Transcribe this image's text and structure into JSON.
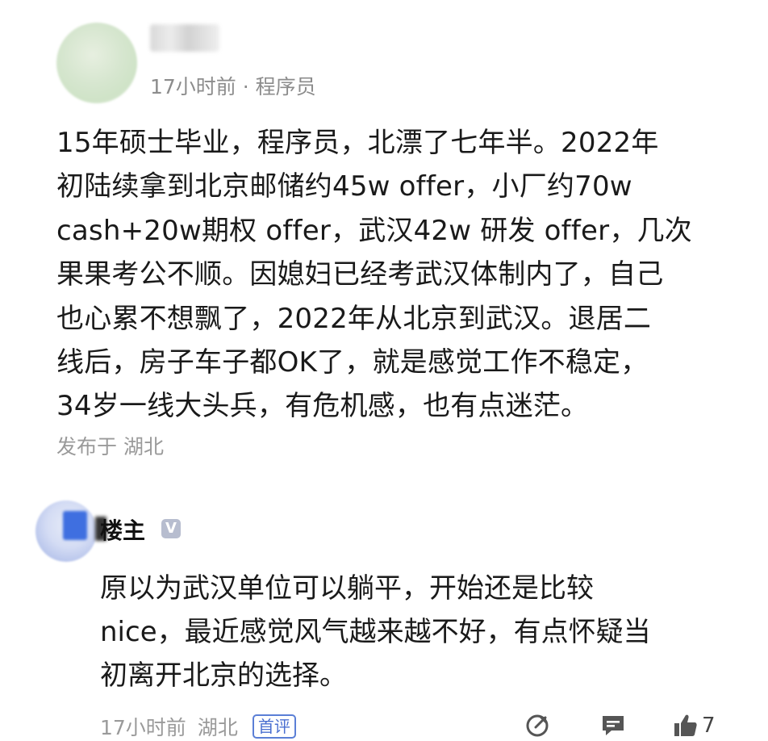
{
  "post": {
    "meta": "17小时前 · 程序员",
    "body_lines": [
      "15年硕士毕业，程序员，北漂了七年半。2022年",
      "初陆续拿到北京邮储约45w offer，小厂约70w",
      "cash+20w期权 offer，武汉42w 研发 offer，几次",
      "果果考公不顺。因媳妇已经考武汉体制内了，自己",
      "也心累不想飘了，2022年从北京到武汉。退居二",
      "线后，房子车子都OK了，就是感觉工作不稳定，",
      "34岁一线大头兵，有危机感，也有点迷茫。"
    ],
    "location": "发布于 湖北"
  },
  "reply": {
    "author": "楼主",
    "verified_mark": "V",
    "body_lines": [
      "原以为武汉单位可以躺平，开始还是比较",
      "nice，最近感觉风气越来越不好，有点怀疑当",
      "初离开北京的选择。"
    ],
    "time": "17小时前",
    "location": "湖北",
    "badge": "首评",
    "like_count": "7",
    "icons": [
      "share-icon",
      "comment-icon",
      "like-icon"
    ]
  },
  "colors": {
    "badge_blue": "#4a6fd0",
    "meta_gray": "#8c8c8c",
    "verified_gray": "#b7bdcf"
  }
}
